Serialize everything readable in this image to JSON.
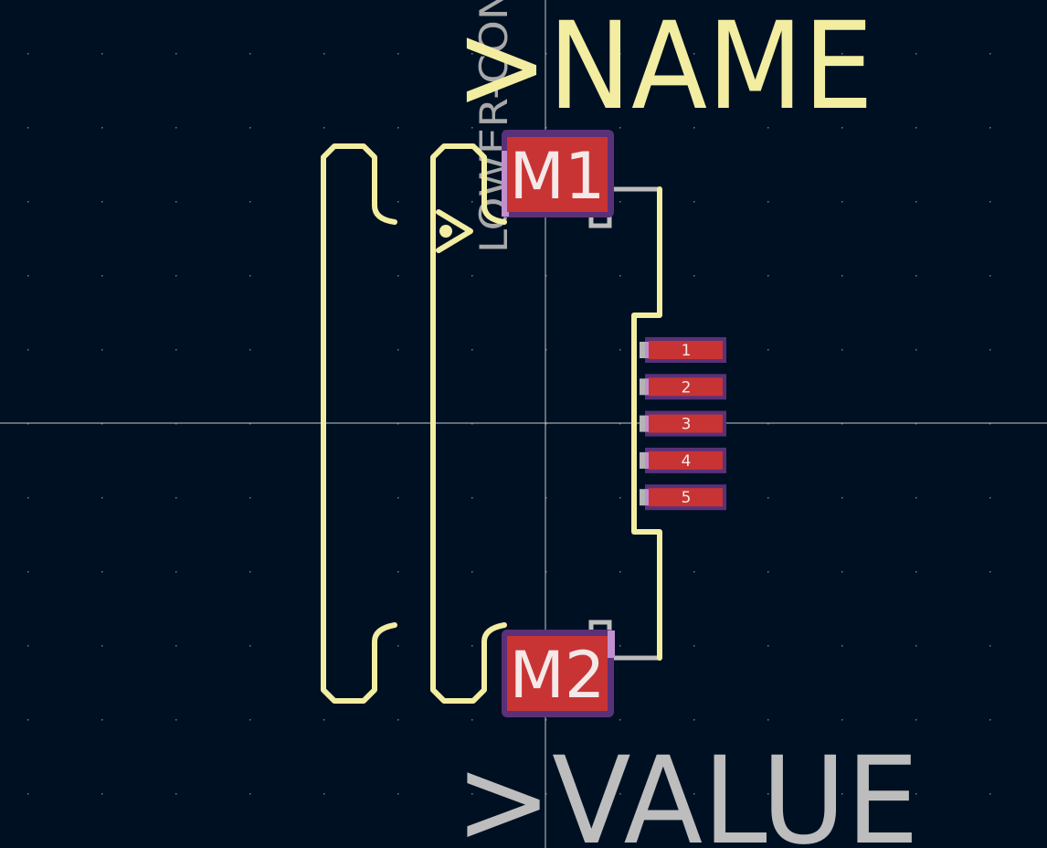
{
  "footprint": {
    "name_field": ">NAME",
    "value_field": ">VALUE",
    "vertical_label": "LOWER-CON",
    "mount_pads": [
      "M1",
      "M2"
    ],
    "signal_pads": [
      "1",
      "2",
      "3",
      "4",
      "5"
    ]
  },
  "colors": {
    "background": "#001023",
    "silkscreen": "#f2eda1",
    "fab": "#bdbdbd",
    "pad": "#c83434",
    "pad_outline": "#5a3178",
    "crosshair": "#c8c8c8"
  }
}
